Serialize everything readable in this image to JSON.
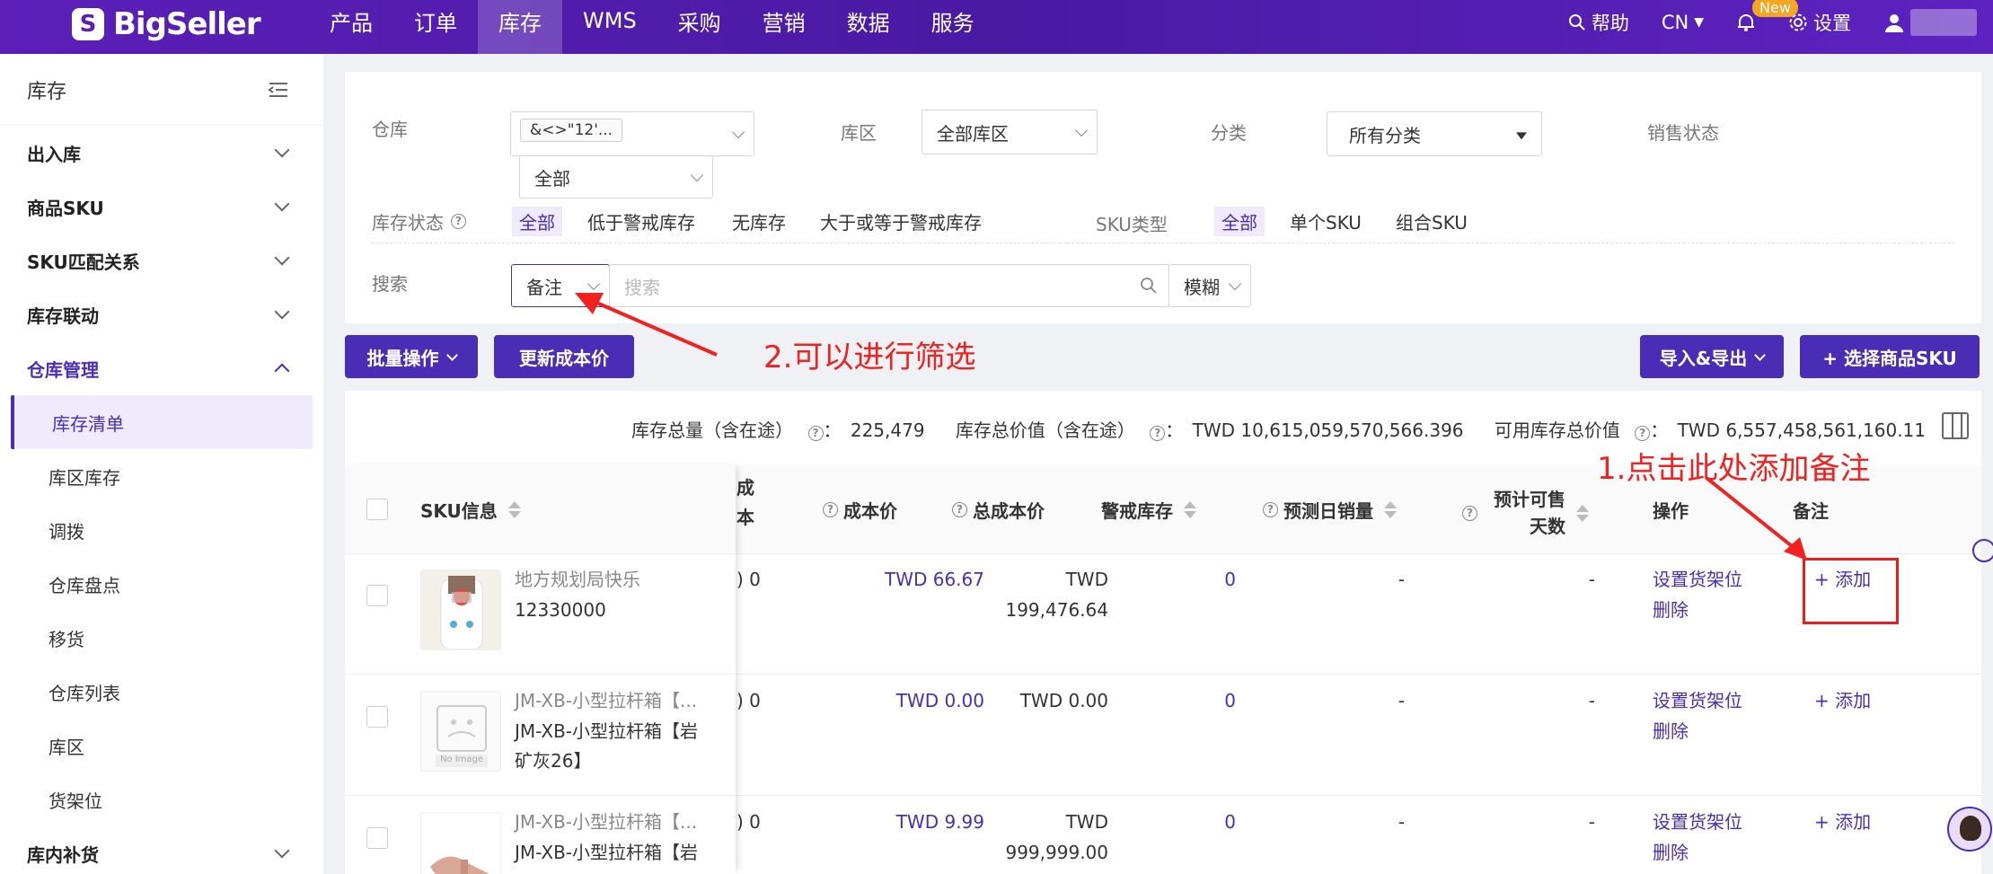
{
  "brand": {
    "name": "BigSeller"
  },
  "nav": {
    "items": [
      "产品",
      "订单",
      "库存",
      "WMS",
      "采购",
      "营销",
      "数据",
      "服务"
    ],
    "active_index": 2,
    "help": "帮助",
    "lang": "CN",
    "new_badge": "New",
    "settings": "设置"
  },
  "sidebar": {
    "title": "库存",
    "groups": [
      {
        "label": "出入库"
      },
      {
        "label": "商品SKU"
      },
      {
        "label": "SKU匹配关系"
      },
      {
        "label": "库存联动"
      },
      {
        "label": "仓库管理"
      }
    ],
    "sub_items": [
      "库存清单",
      "库区库存",
      "调拨",
      "仓库盘点",
      "移货",
      "仓库列表",
      "库区",
      "货架位"
    ],
    "last_group": "库内补货"
  },
  "filter": {
    "warehouse_label": "仓库",
    "warehouse_tag": "&<>\"12'...",
    "warehouse_sub": "全部",
    "zone_label": "库区",
    "zone_value": "全部库区",
    "category_label": "分类",
    "category_value": "所有分类",
    "sales_status_label": "销售状态",
    "stock_status_label": "库存状态",
    "stock_status_options": [
      "全部",
      "低于警戒库存",
      "无库存",
      "大于或等于警戒库存"
    ],
    "sku_type_label": "SKU类型",
    "sku_type_options": [
      "全部",
      "单个SKU",
      "组合SKU"
    ],
    "search_label": "搜索",
    "search_field": "备注",
    "search_placeholder": "搜索",
    "match_mode": "模糊"
  },
  "actions": {
    "bulk": "批量操作",
    "update_cost": "更新成本价",
    "import_export": "导入&导出",
    "select_sku": "+ 选择商品SKU"
  },
  "annotations": {
    "a1": "1.点击此处添加备注",
    "a2": "2.可以进行筛选"
  },
  "summary": {
    "total_qty_label": "库存总量（含在途）",
    "total_qty": "225,479",
    "total_value_label": "库存总价值（含在途）",
    "total_value": "TWD 10,615,059,570,566.396",
    "avail_value_label": "可用库存总价值",
    "avail_value": "TWD 6,557,458,561,160.11"
  },
  "table": {
    "headers": {
      "sku_info": "SKU信息",
      "partial_a": "成",
      "partial_b": "本",
      "cost": "成本价",
      "total_cost": "总成本价",
      "alert_stock": "警戒库存",
      "forecast_sales": "预测日销量",
      "days_a": "预计可售",
      "days_b": "天数",
      "ops": "操作",
      "remark": "备注"
    },
    "rows": [
      {
        "title": "地方规划局快乐",
        "code": "12330000",
        "partial": ") 0",
        "cost": "TWD 66.67",
        "total_a": "TWD",
        "total_b": "199,476.64",
        "alert": "0",
        "forecast": "-",
        "days": "-",
        "op1": "设置货架位",
        "op2": "删除",
        "remark": "+ 添加"
      },
      {
        "title": "JM-XB-小型拉杆箱【...",
        "code": "JM-XB-小型拉杆箱【岩",
        "code2": "矿灰26】",
        "partial": ") 0",
        "cost": "TWD 0.00",
        "total_a": "TWD 0.00",
        "total_b": "",
        "alert": "0",
        "forecast": "-",
        "days": "-",
        "op1": "设置货架位",
        "op2": "删除",
        "remark": "+ 添加"
      },
      {
        "title": "JM-XB-小型拉杆箱【...",
        "code": "JM-XB-小型拉杆箱【岩",
        "partial": ") 0",
        "cost": "TWD 9.99",
        "total_a": "TWD",
        "total_b": "999,999.00",
        "alert": "0",
        "forecast": "-",
        "days": "-",
        "op1": "设置货架位",
        "op2": "删除",
        "remark": "+ 添加"
      }
    ],
    "no_image": "No Image"
  }
}
